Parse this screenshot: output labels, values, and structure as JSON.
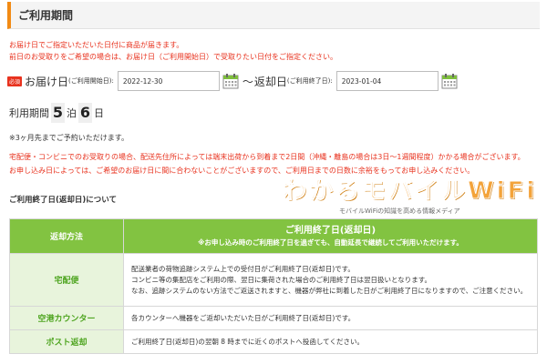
{
  "section": {
    "title": "ご利用期間"
  },
  "intro": {
    "line1": "お届け日でご指定いただいた日付に商品が届きます。",
    "line2": "前日のお受取りをご希望の場合は、お届け日（ご利用開始日）で受取りたい日付をご指定ください。"
  },
  "form": {
    "required_badge": "必須",
    "delivery_label": "お届け日",
    "delivery_sub": "(ご利用開始日):",
    "delivery_value": "2022-12-30",
    "tilde": "〜",
    "return_label": "返却日",
    "return_sub": "(ご利用終了日):",
    "return_value": "2023-01-04"
  },
  "period": {
    "label": "利用期間",
    "nights": "5",
    "nights_unit": "泊",
    "days": "6",
    "days_unit": "日"
  },
  "notes": {
    "advance": "※3ヶ月先までご予約いただけます。",
    "red1": "宅配便・コンビニでのお受取りの場合、配送先住所によっては端末出荷から到着まで2日間（沖縄・離島の場合は3日〜1週間程度）かかる場合がございます。",
    "red2": "お申し込み日によっては、ご希望のお届け日に間に合わないことがございますので、ご利用日までの日数に余裕をもってお申し込みください。"
  },
  "about_title": "ご利用終了日(返却日)について",
  "watermark": {
    "main": "わかるモバイルWiFi",
    "sub": "モバイルWiFiの知識を高める情報メディア"
  },
  "table": {
    "header_left": "返却方法",
    "header_right_title": "ご利用終了日(返却日)",
    "header_right_sub": "※お申し込み時のご利用終了日を過ぎても、自動延長で継続してご利用いただけます。",
    "rows": [
      {
        "method": "宅配便",
        "desc1": "配送業者の荷物追跡システム上での受付日がご利用終了日(返却日)です。",
        "desc2": "コンビニ等の集配店をご利用の際、翌日に集荷された場合のご利用終了日は翌日扱いとなります。",
        "desc3": "なお、追跡システムのない方法でご返送されますと、機器が弊社に到着した日がご利用終了日になりますので、ご注意ください。"
      },
      {
        "method": "空港カウンター",
        "desc1": "各カウンターへ機器をご返却いただいた日がご利用終了日(返却日)です。"
      },
      {
        "method": "ポスト返却",
        "desc1": "ご利用終了日(返却日)の翌朝 8 時までに近くのポストへ投函してください。"
      }
    ]
  },
  "colors": {
    "accent_orange": "#f28a14",
    "alert_red": "#e8321e",
    "table_green": "#82c341",
    "table_green_light": "#e8f4dc",
    "method_text_green": "#4fa521"
  },
  "icons": {
    "calendar": "calendar-icon"
  }
}
